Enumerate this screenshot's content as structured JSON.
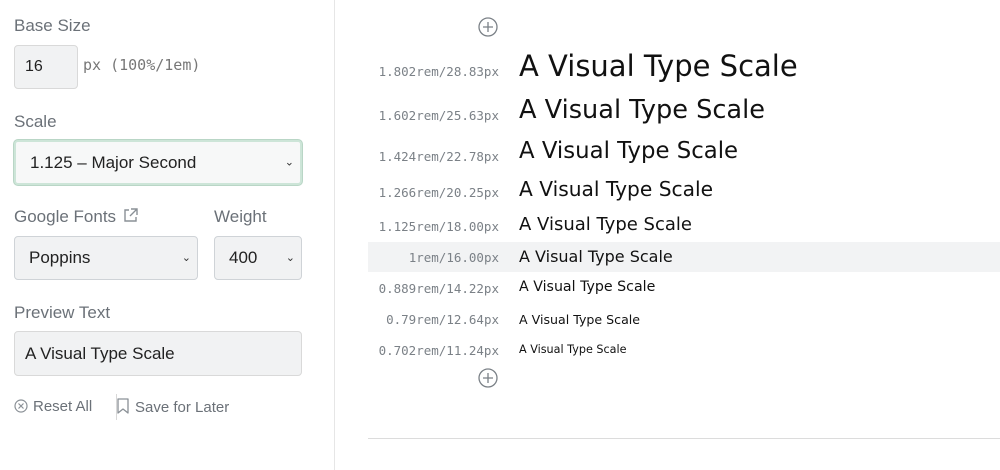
{
  "sidebar": {
    "base_size_label": "Base Size",
    "base_size_value": "16",
    "base_size_unit": "px (100%/1em)",
    "scale_label": "Scale",
    "scale_value": "1.125 – Major Second",
    "fonts_label": "Google Fonts",
    "font_value": "Poppins",
    "weight_label": "Weight",
    "weight_value": "400",
    "preview_label": "Preview Text",
    "preview_value": "A Visual Type Scale",
    "reset_label": "Reset All",
    "save_label": "Save for Later"
  },
  "scale_rows": [
    {
      "size": "1.802rem/28.83px",
      "text": "A Visual Type Scale"
    },
    {
      "size": "1.602rem/25.63px",
      "text": "A Visual Type Scale"
    },
    {
      "size": "1.424rem/22.78px",
      "text": "A Visual Type Scale"
    },
    {
      "size": "1.266rem/20.25px",
      "text": "A Visual Type Scale"
    },
    {
      "size": "1.125rem/18.00px",
      "text": "A Visual Type Scale"
    },
    {
      "size": "1rem/16.00px",
      "text": "A Visual Type Scale"
    },
    {
      "size": "0.889rem/14.22px",
      "text": "A Visual Type Scale"
    },
    {
      "size": "0.79rem/12.64px",
      "text": "A Visual Type Scale"
    },
    {
      "size": "0.702rem/11.24px",
      "text": "A Visual Type Scale"
    }
  ],
  "icons": {
    "add_top": "plus-circle-icon",
    "add_bottom": "plus-circle-icon",
    "external": "external-link-icon",
    "reset": "close-circle-icon",
    "save": "bookmark-icon"
  }
}
